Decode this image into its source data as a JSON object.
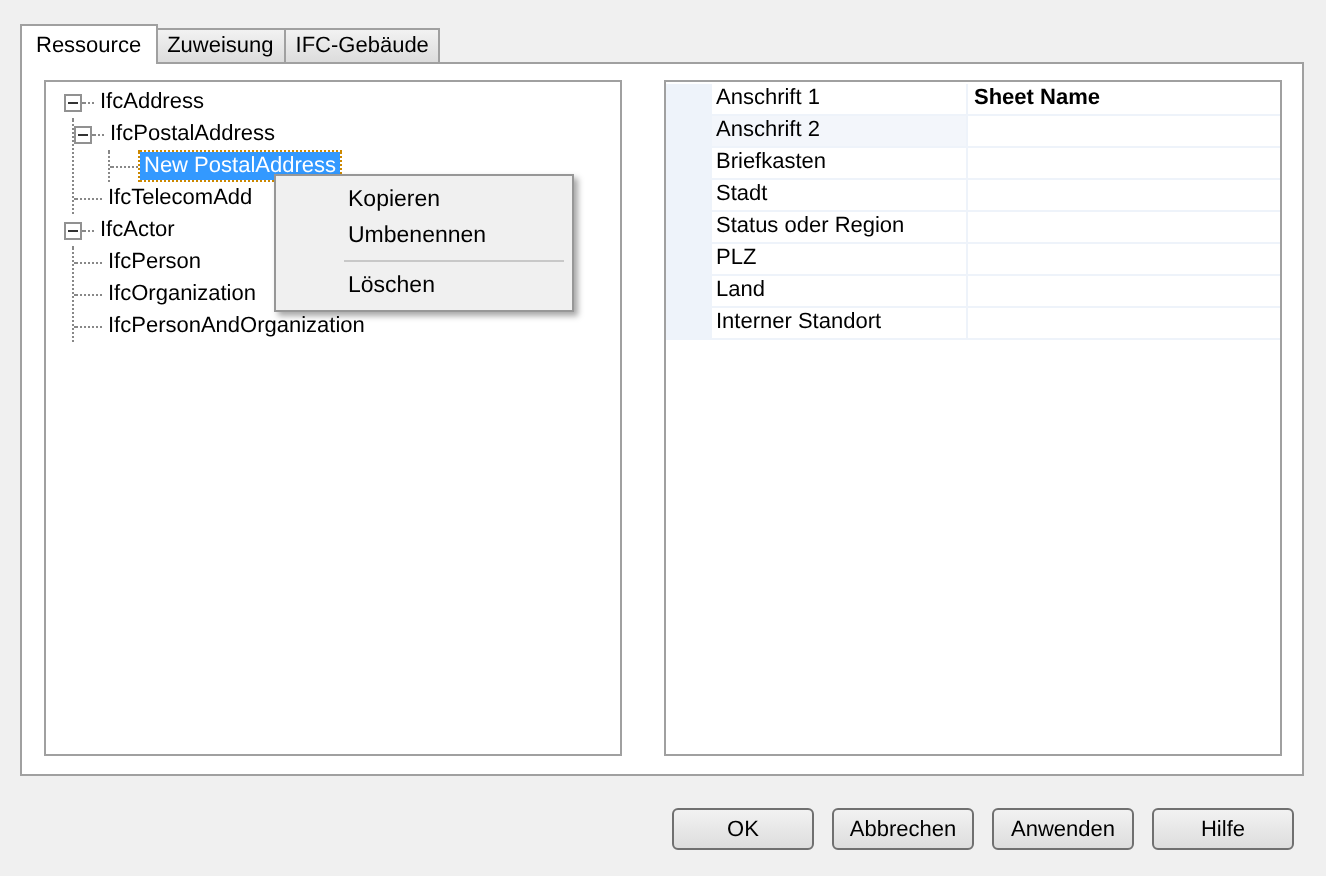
{
  "tabs": [
    {
      "label": "Ressource",
      "selected": true
    },
    {
      "label": "Zuweisung",
      "selected": false
    },
    {
      "label": "IFC-Gebäude",
      "selected": false
    }
  ],
  "tree": [
    {
      "label": "IfcAddress",
      "expanded": true,
      "selected": false,
      "children": [
        {
          "label": "IfcPostalAddress",
          "expanded": true,
          "selected": false,
          "children": [
            {
              "label": "New PostalAddress",
              "selected": true
            }
          ]
        },
        {
          "label": "IfcTelecomAdd",
          "selected": false
        }
      ]
    },
    {
      "label": "IfcActor",
      "expanded": true,
      "selected": false,
      "children": [
        {
          "label": "IfcPerson",
          "selected": false
        },
        {
          "label": "IfcOrganization",
          "selected": false
        },
        {
          "label": "IfcPersonAndOrganization",
          "selected": false
        }
      ]
    }
  ],
  "context_menu": [
    {
      "kind": "item",
      "label": "Kopieren"
    },
    {
      "kind": "item",
      "label": "Umbenennen"
    },
    {
      "kind": "separator"
    },
    {
      "kind": "item",
      "label": "Löschen"
    }
  ],
  "properties": [
    {
      "label": "Anschrift 1",
      "value": "Sheet Name",
      "bold": true,
      "selected": false
    },
    {
      "label": "Anschrift 2",
      "selected": true
    },
    {
      "label": "Briefkasten",
      "selected": false
    },
    {
      "label": "Stadt",
      "selected": false
    },
    {
      "label": "Status oder Region",
      "selected": false
    },
    {
      "label": "PLZ",
      "selected": false
    },
    {
      "label": "Land",
      "selected": false
    },
    {
      "label": "Interner Standort",
      "selected": false
    }
  ],
  "buttons": [
    "OK",
    "Abbrechen",
    "Anwenden",
    "Hilfe"
  ]
}
